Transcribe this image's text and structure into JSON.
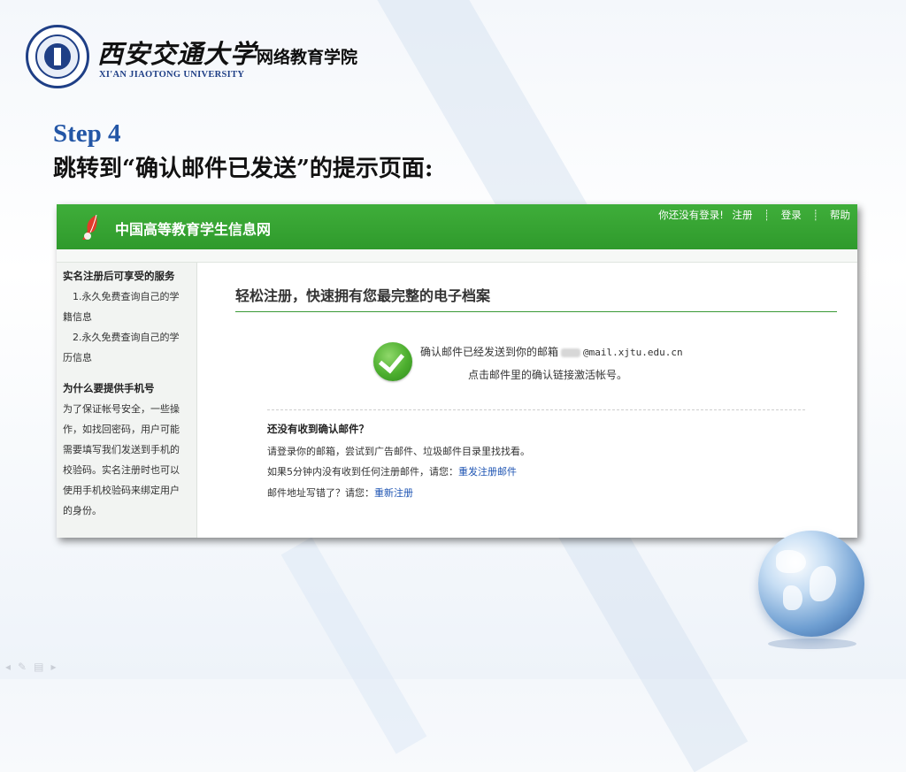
{
  "slide": {
    "logo": {
      "school_name_cn": "西安交通大学",
      "college_name": "网络教育学院",
      "school_name_en": "XI'AN JIAOTONG UNIVERSITY"
    },
    "step_title": "Step 4",
    "step_desc": "跳转到“确认邮件已发送”的提示页面:"
  },
  "site": {
    "title": "中国高等教育学生信息网",
    "nav": {
      "status": "你还没有登录!",
      "register": "注册",
      "login": "登录",
      "help": "帮助"
    },
    "sidebar": {
      "section1_title": "实名注册后可享受的服务",
      "section1_items": [
        "1.永久免费查询自己的学",
        "籍信息",
        "2.永久免费查询自己的学",
        "历信息"
      ],
      "section2_title": "为什么要提供手机号",
      "section2_lines": [
        "为了保证帐号安全，一些操",
        "作，如找回密码，用户可能",
        "需要填写我们发送到手机的",
        "校验码。实名注册时也可以",
        "使用手机校验码来绑定用户",
        "的身份。"
      ]
    },
    "main": {
      "title": "轻松注册，快速拥有您最完整的电子档案",
      "confirm_prefix": "确认邮件已经发送到你的邮箱",
      "confirm_email_domain": "@mail.xjtu.edu.cn",
      "confirm_line2": "点击邮件里的确认链接激活帐号。",
      "help_title": "还没有收到确认邮件？",
      "help_line1": "请登录你的邮箱，尝试到广告邮件、垃圾邮件目录里找找看。",
      "help_line2_prefix": "如果5分钟内没有收到任何注册邮件，请您：",
      "help_line2_link": "重发注册邮件",
      "help_line3_prefix": "邮件地址写错了？请您：",
      "help_line3_link": "重新注册"
    }
  },
  "colors": {
    "header_green": "#3fae3a",
    "link_blue": "#1f55b3",
    "step_blue": "#2356a6"
  },
  "slide_controls": [
    "◂",
    "✎",
    "▤",
    "▸"
  ]
}
